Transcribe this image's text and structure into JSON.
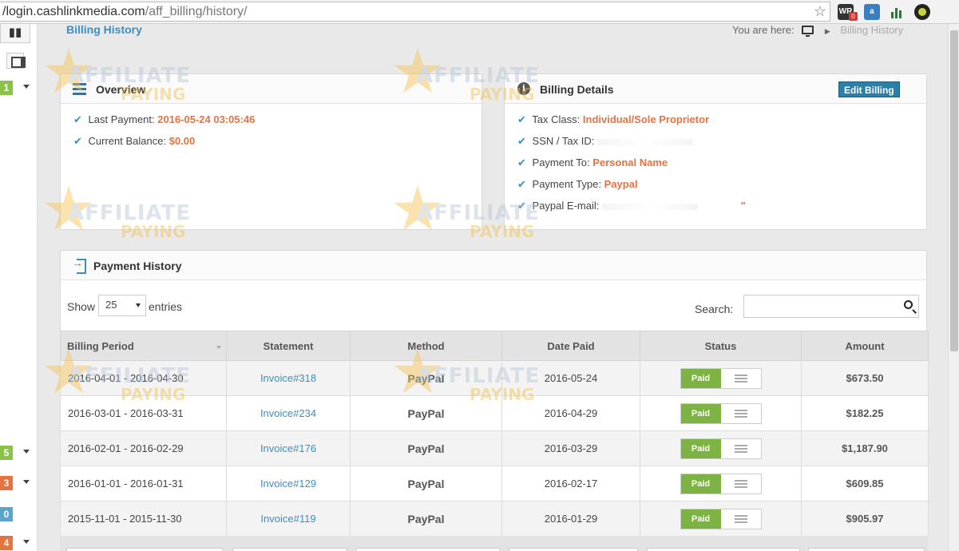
{
  "browser": {
    "url_main": "/login.cashlinkmedia.com",
    "url_path": "/aff_billing/history/"
  },
  "sidebar": {
    "badges": [
      {
        "label": "1",
        "color": "#8bc34a"
      },
      {
        "label": "5",
        "color": "#8bc34a"
      },
      {
        "label": "3",
        "color": "#e5733f"
      },
      {
        "label": "0",
        "color": "#5aa5c9"
      },
      {
        "label": "4",
        "color": "#e5733f"
      }
    ]
  },
  "header": {
    "title": "Billing History",
    "you_are_here": "You are here:",
    "current": "Billing History"
  },
  "overview": {
    "title": "Overview",
    "last_payment_label": "Last Payment:",
    "last_payment_value": "2016-05-24 03:05:46",
    "balance_label": "Current Balance:",
    "balance_value": "$0.00"
  },
  "billing_details": {
    "title": "Billing Details",
    "edit_button": "Edit Billing",
    "tax_class_label": "Tax Class:",
    "tax_class_value": "Individual/Sole Proprietor",
    "ssn_label": "SSN / Tax ID:",
    "payment_to_label": "Payment To:",
    "payment_to_value": "Personal Name",
    "payment_type_label": "Payment Type:",
    "payment_type_value": "Paypal",
    "paypal_email_label": "Paypal E-mail:",
    "paypal_email_tail": "\""
  },
  "payment_history": {
    "title": "Payment History",
    "show_label": "Show",
    "entries_value": "25",
    "entries_label": "entries",
    "search_label": "Search:",
    "columns": [
      "Billing Period",
      "Statement",
      "Method",
      "Date Paid",
      "Status",
      "Amount"
    ],
    "rows": [
      {
        "period": "2016-04-01 - 2016-04-30",
        "statement": "Invoice#318",
        "method": "PayPal",
        "date_paid": "2016-05-24",
        "status": "Paid",
        "amount": "$673.50"
      },
      {
        "period": "2016-03-01 - 2016-03-31",
        "statement": "Invoice#234",
        "method": "PayPal",
        "date_paid": "2016-04-29",
        "status": "Paid",
        "amount": "$182.25"
      },
      {
        "period": "2016-02-01 - 2016-02-29",
        "statement": "Invoice#176",
        "method": "PayPal",
        "date_paid": "2016-03-29",
        "status": "Paid",
        "amount": "$1,187.90"
      },
      {
        "period": "2016-01-01 - 2016-01-31",
        "statement": "Invoice#129",
        "method": "PayPal",
        "date_paid": "2016-02-17",
        "status": "Paid",
        "amount": "$609.85"
      },
      {
        "period": "2015-11-01 - 2015-11-30",
        "statement": "Invoice#119",
        "method": "PayPal",
        "date_paid": "2016-01-29",
        "status": "Paid",
        "amount": "$905.97"
      }
    ]
  },
  "watermark": {
    "line1": "AFFILIATE",
    "line2": "PAYING"
  }
}
